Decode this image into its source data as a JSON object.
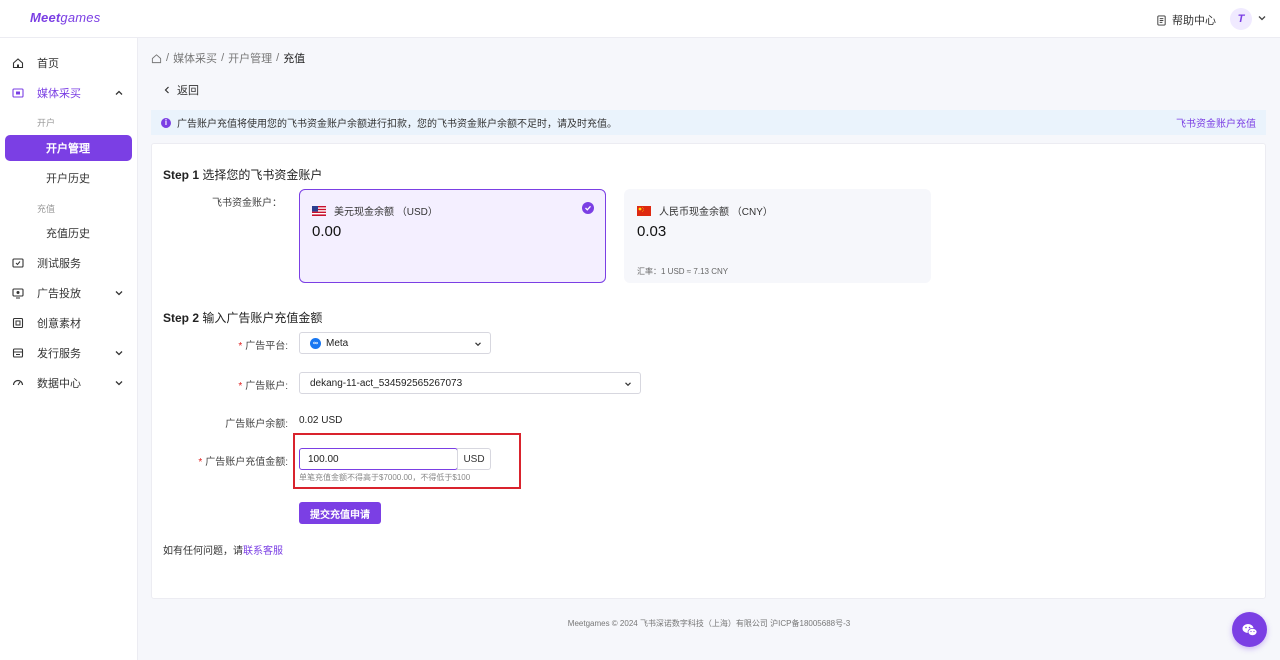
{
  "brand": {
    "logo_main": "Meet",
    "logo_sub": "games",
    "accent": "#7b3fe4"
  },
  "header": {
    "help_label": "帮助中心",
    "avatar_initial": "T"
  },
  "sidebar": {
    "home": "首页",
    "media": "媒体采买",
    "group_open": "开户",
    "account_mgmt": "开户管理",
    "account_history": "开户历史",
    "group_recharge": "充值",
    "recharge_history": "充值历史",
    "test_service": "测试服务",
    "ad_delivery": "广告投放",
    "creative": "创意素材",
    "publish": "发行服务",
    "data_center": "数据中心"
  },
  "breadcrumb": {
    "sep": "/",
    "item1": "媒体采买",
    "item2": "开户管理",
    "current": "充值"
  },
  "back_label": "返回",
  "notice": {
    "message": "广告账户充值将使用您的飞书资金账户余额进行扣款，您的飞书资金账户余额不足时，请及时充值。",
    "link": "飞书资金账户充值"
  },
  "step1": {
    "prefix": "Step 1",
    "title": "选择您的飞书资金账户",
    "field_label": "飞书资金账户：",
    "usd": {
      "label": "美元现金余额 （USD）",
      "amount": "0.00",
      "selected": true
    },
    "cny": {
      "label": "人民币现金余额 （CNY）",
      "amount": "0.03",
      "rate": "汇率：1 USD ≈ 7.13 CNY"
    }
  },
  "step2": {
    "prefix": "Step 2",
    "title": "输入广告账户充值金额",
    "platform_label": "广告平台:",
    "platform_value": "Meta",
    "account_label": "广告账户:",
    "account_value": "dekang-11-act_534592565267073",
    "balance_label": "广告账户余额:",
    "balance_value": "0.02 USD",
    "amount_label": "广告账户充值金额:",
    "amount_value": "100.00",
    "amount_unit": "USD",
    "hint": "单笔充值金额不得高于$7000.00，不得低于$100",
    "submit": "提交充值申请"
  },
  "contact": {
    "text": "如有任何问题，请",
    "link": "联系客服"
  },
  "footer": "Meetgames © 2024 飞书深诺数字科技（上海）有限公司 沪ICP备18005688号-3",
  "icons": {
    "home": "home-icon",
    "media": "media-icon",
    "test": "test-icon",
    "ad": "ad-icon",
    "creative": "creative-icon",
    "publish": "publish-icon",
    "data": "data-icon",
    "chat": "wechat-icon"
  }
}
